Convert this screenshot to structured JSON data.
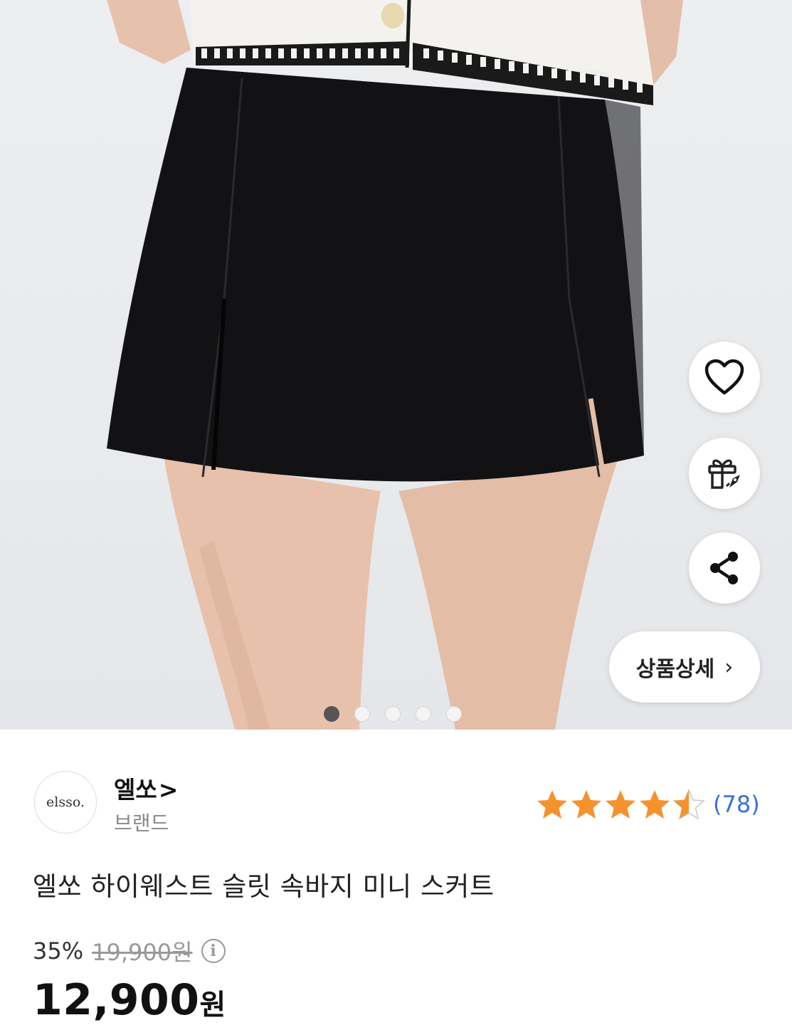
{
  "hero": {
    "image_alt": "black mini skort product photo",
    "total_slides": 5,
    "active_slide": 1,
    "actions": [
      {
        "name": "like",
        "icon": "heart-icon"
      },
      {
        "name": "gift",
        "icon": "gift-icon"
      },
      {
        "name": "share",
        "icon": "share-icon"
      }
    ],
    "detail_button": {
      "label": "상품상세",
      "chevron": "›"
    }
  },
  "brand": {
    "logo_text": "elsso.",
    "name": "엘쏘",
    "arrow": ">",
    "type": "브랜드"
  },
  "rating": {
    "score": 4.5,
    "max": 5,
    "review_count": "(78)",
    "star_color": "#f5922e"
  },
  "product": {
    "title": "엘쏘 하이웨스트 슬릿 속바지 미니 스커트"
  },
  "price": {
    "discount": "35%",
    "original": "19,900원",
    "sale_amount": "12,900",
    "sale_unit": "원",
    "info_icon": "i"
  }
}
